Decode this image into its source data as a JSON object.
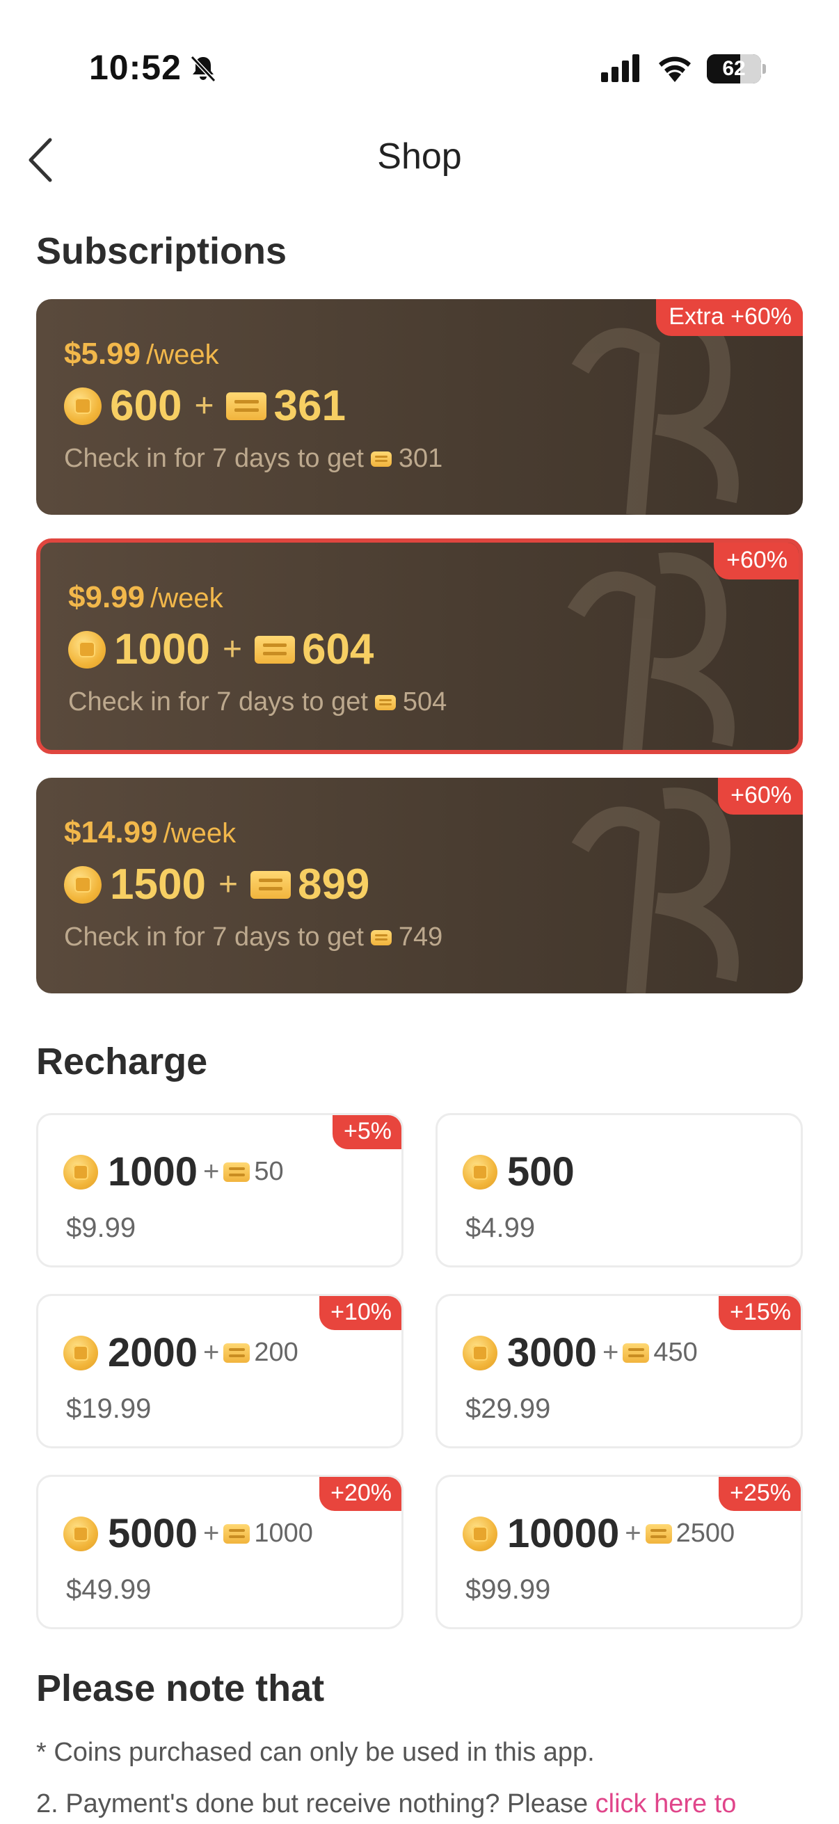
{
  "status_bar": {
    "time": "10:52",
    "battery": "62",
    "battery_percent": 62
  },
  "nav": {
    "title": "Shop"
  },
  "subscriptions": {
    "title": "Subscriptions",
    "plans": [
      {
        "badge": "Extra +60%",
        "price": "$5.99",
        "period": "/week",
        "coins": "600",
        "plus": "+",
        "bonus": "361",
        "note": "Check in for 7 days to get",
        "checkin": "301"
      },
      {
        "badge": "+60%",
        "price": "$9.99",
        "period": "/week",
        "coins": "1000",
        "plus": "+",
        "bonus": "604",
        "note": "Check in for 7 days to get",
        "checkin": "504",
        "selected": true
      },
      {
        "badge": "+60%",
        "price": "$14.99",
        "period": "/week",
        "coins": "1500",
        "plus": "+",
        "bonus": "899",
        "note": "Check in for 7 days to get",
        "checkin": "749"
      }
    ]
  },
  "recharge": {
    "title": "Recharge",
    "packs": [
      {
        "badge": "+5%",
        "coins": "1000",
        "plus": "+",
        "bonus": "50",
        "price": "$9.99"
      },
      {
        "badge": "",
        "coins": "500",
        "plus": "",
        "bonus": "",
        "price": "$4.99"
      },
      {
        "badge": "+10%",
        "coins": "2000",
        "plus": "+",
        "bonus": "200",
        "price": "$19.99"
      },
      {
        "badge": "+15%",
        "coins": "3000",
        "plus": "+",
        "bonus": "450",
        "price": "$29.99"
      },
      {
        "badge": "+20%",
        "coins": "5000",
        "plus": "+",
        "bonus": "1000",
        "price": "$49.99"
      },
      {
        "badge": "+25%",
        "coins": "10000",
        "plus": "+",
        "bonus": "2500",
        "price": "$99.99"
      }
    ]
  },
  "notes": {
    "title": "Please note that",
    "line1": "* Coins purchased can only be used in this app.",
    "line2_text": "2. Payment's done but receive nothing? Please ",
    "line2_link": "click here to"
  },
  "colors": {
    "accent_red": "#e8453d",
    "link_pink": "#e0458a",
    "gold": "#f2b84b",
    "card_brown": "#4a3d31"
  },
  "icons": [
    "bell-slash-icon",
    "cellular-signal-icon",
    "wifi-icon",
    "battery-icon",
    "back-chevron-icon",
    "coin-icon",
    "ticket-icon"
  ]
}
